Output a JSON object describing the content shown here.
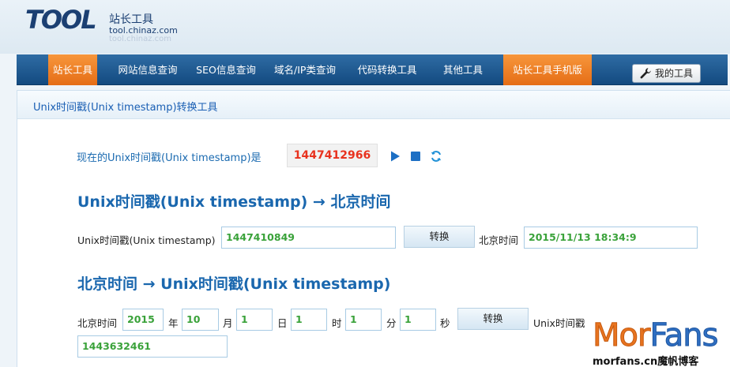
{
  "logo": {
    "main": "TOOL",
    "cn": "站长工具",
    "sub": "tool.chinaz.com",
    "reflect": "tool.chinaz.com"
  },
  "nav": {
    "items": [
      {
        "label": "站长工具",
        "active": true
      },
      {
        "label": "网站信息查询",
        "active": false
      },
      {
        "label": "SEO信息查询",
        "active": false
      },
      {
        "label": "域名/IP类查询",
        "active": false
      },
      {
        "label": "代码转换工具",
        "active": false
      },
      {
        "label": "其他工具",
        "active": false
      },
      {
        "label": "站长工具手机版",
        "active": true
      }
    ],
    "my_tools": "我的工具",
    "my_tools_icon": "wrench-icon"
  },
  "panel": {
    "title": "Unix时间戳(Unix timestamp)转换工具"
  },
  "now": {
    "label": "现在的Unix时间戳(Unix timestamp)是",
    "value": "1447412966",
    "icons": [
      "play-icon",
      "stop-icon",
      "refresh-icon"
    ]
  },
  "section1": {
    "title": "Unix时间戳(Unix timestamp) → 北京时间",
    "input_label": "Unix时间戳(Unix timestamp)",
    "input_value": "1447410849",
    "button": "转换",
    "result_label": "北京时间",
    "result_value": "2015/11/13 18:34:9"
  },
  "section2": {
    "title": "北京时间 → Unix时间戳(Unix timestamp)",
    "prefix": "北京时间",
    "year": "2015",
    "year_unit": "年",
    "month": "10",
    "month_unit": "月",
    "day": "1",
    "day_unit": "日",
    "hour": "1",
    "hour_unit": "时",
    "minute": "1",
    "minute_unit": "分",
    "second": "1",
    "second_unit": "秒",
    "button": "转换",
    "result_label": "Unix时间戳",
    "result_value": "1443632461"
  },
  "watermark": {
    "orange_part": "Mor",
    "blue_part": "Fans",
    "small": "morfans.cn魔帆博客"
  },
  "colors": {
    "nav_bg": "#1f5a92",
    "nav_active": "#ee7f26",
    "link_blue": "#1a67ae",
    "timestamp_red": "#e8321e",
    "value_green": "#3aa23a"
  }
}
